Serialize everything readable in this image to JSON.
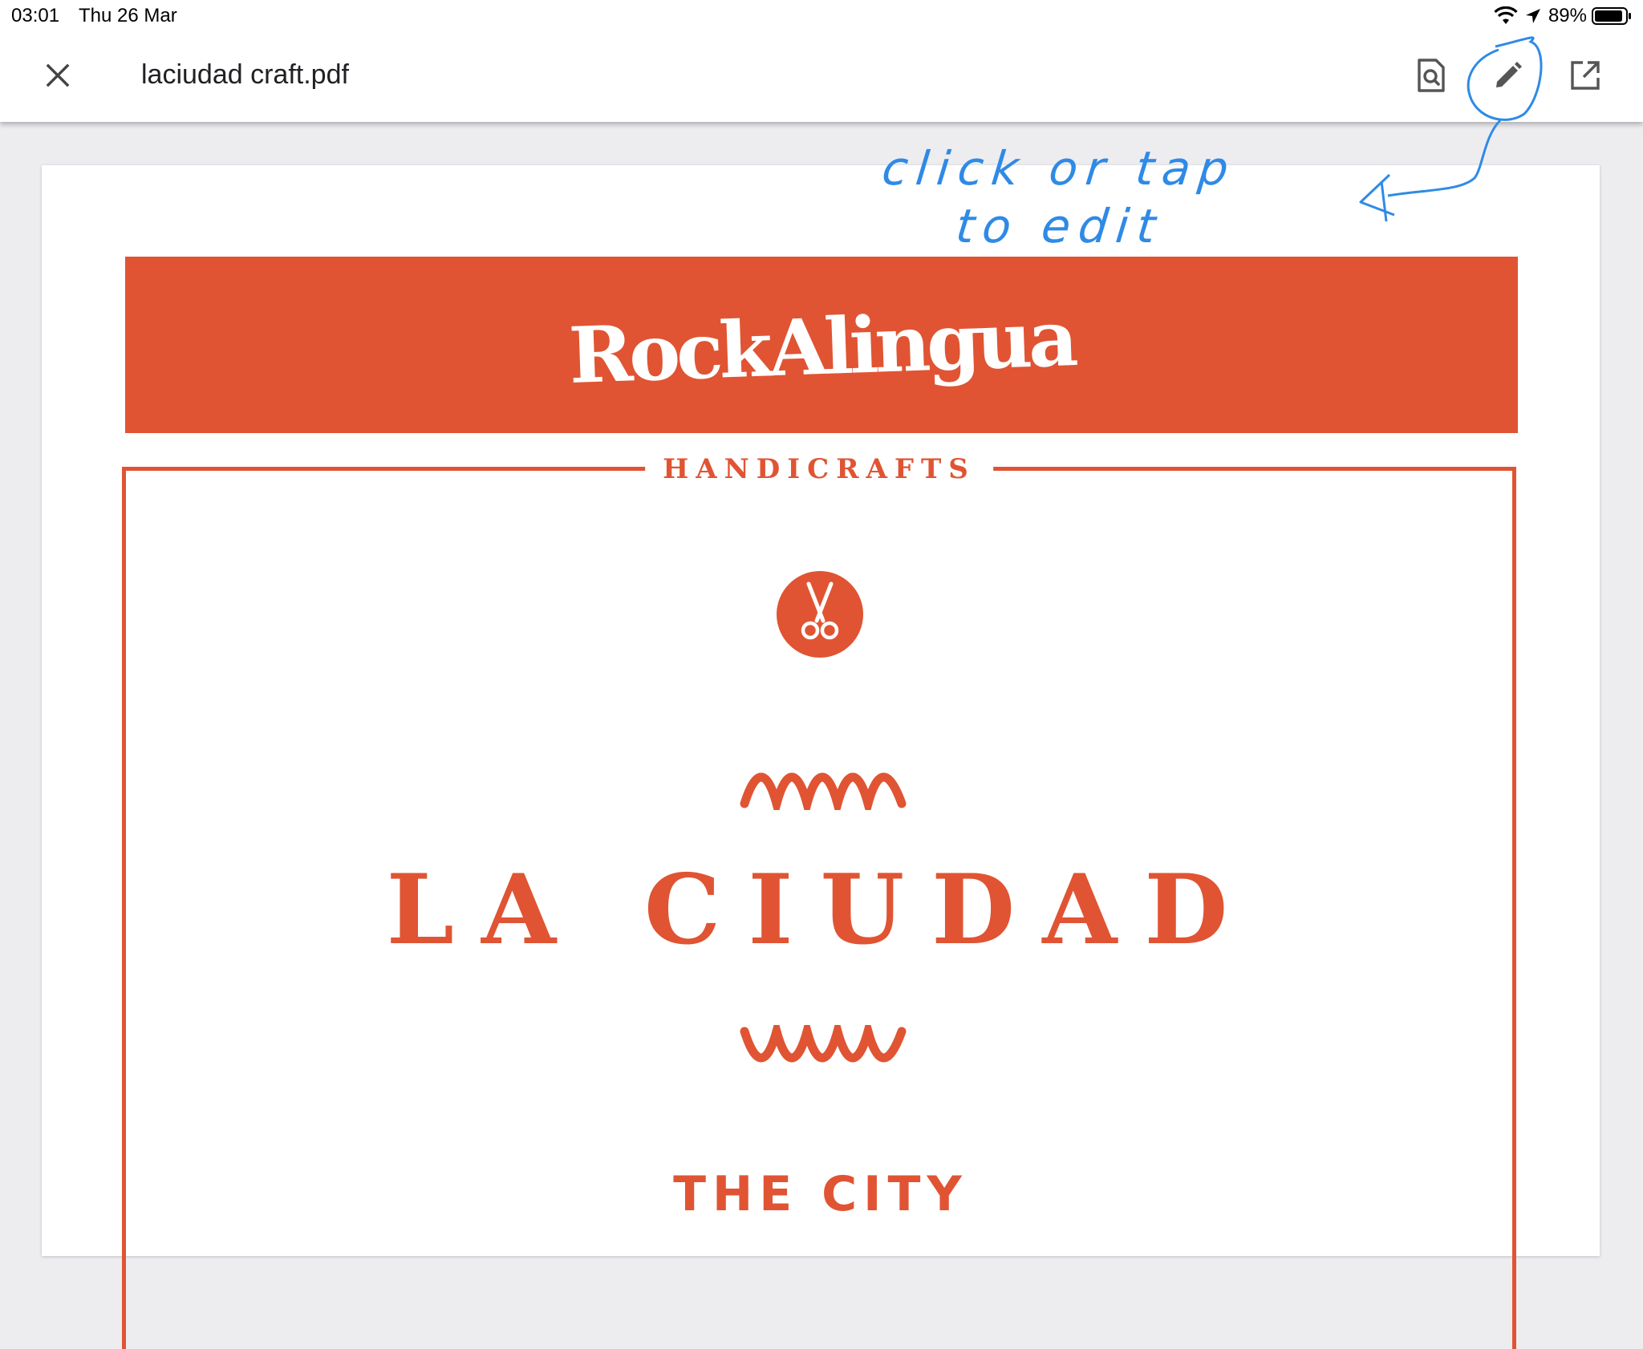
{
  "status_bar": {
    "time": "03:01",
    "date": "Thu 26 Mar",
    "battery": "89%"
  },
  "toolbar": {
    "title": "laciudad craft.pdf",
    "close_icon": "close-icon",
    "search_icon": "find-in-document-icon",
    "edit_icon": "pencil-icon",
    "open_icon": "open-external-icon"
  },
  "document": {
    "logo": "RockAlingua",
    "section_label": "HANDICRAFTS",
    "title": "LA CIUDAD",
    "subtitle": "THE CITY",
    "accent_color": "#e05433"
  },
  "annotation": {
    "line1": "click  or  tap",
    "line2": "to  edit",
    "color": "#2f8ae6"
  }
}
